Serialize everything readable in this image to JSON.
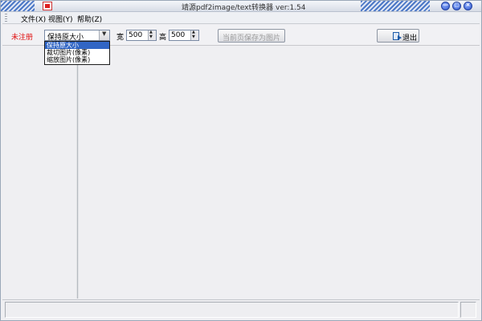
{
  "window": {
    "title": "靖源pdf2image/text转换器 ver:1.54"
  },
  "title_buttons": [
    {
      "label": "—",
      "icon": "minimize-icon"
    },
    {
      "label": "▢",
      "icon": "maximize-icon"
    },
    {
      "label": "×",
      "icon": "close-icon"
    }
  ],
  "menu": {
    "file": "文件(X)",
    "view": "视图(Y)",
    "help": "帮助(Z)"
  },
  "toolbar": {
    "unregistered": "未注册",
    "size_mode": {
      "value": "保持原大小",
      "options": [
        "保持原大小",
        "裁切图片(像素)",
        "缩放图片(像素)"
      ],
      "selected_index": 0
    },
    "width_label": "宽",
    "width_value": "500",
    "height_label": "高",
    "height_value": "500",
    "save_page_label": "当前页保存为图片",
    "exit_label": "退出"
  },
  "colors": {
    "unregistered_text": "#e01010",
    "selection_bg": "#3166c5",
    "title_accent": "#4c78c6"
  }
}
